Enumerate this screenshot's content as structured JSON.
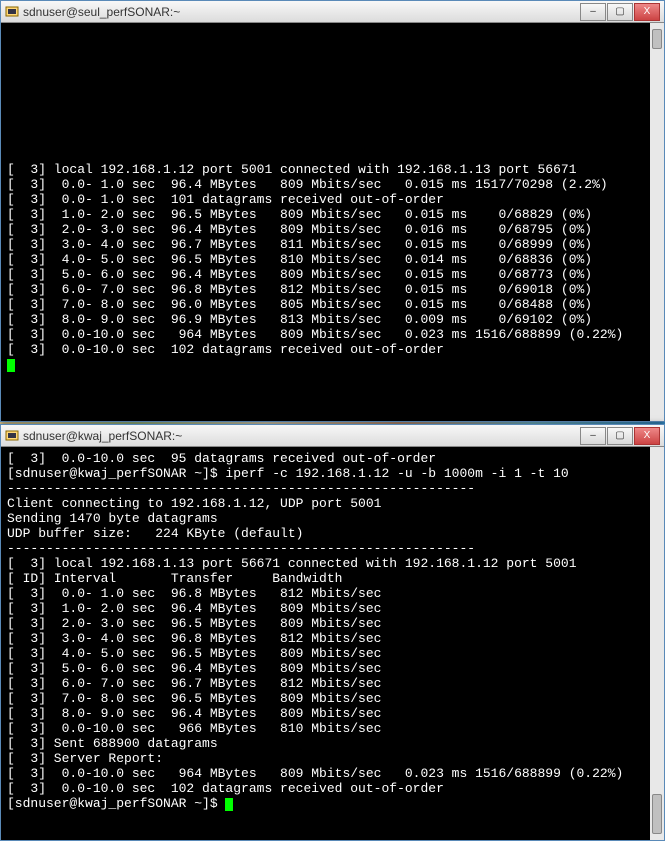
{
  "window1": {
    "title": "sdnuser@seul_perfSONAR:~",
    "server": {
      "connected": "[  3] local 192.168.1.12 port 5001 connected with 192.168.1.13 port 56671",
      "first_row": "[  3]  0.0- 1.0 sec  96.4 MBytes   809 Mbits/sec   0.015 ms 1517/70298 (2.2%)",
      "out_of_order_1": "[  3]  0.0- 1.0 sec  101 datagrams received out-of-order",
      "rows": [
        "[  3]  1.0- 2.0 sec  96.5 MBytes   809 Mbits/sec   0.015 ms    0/68829 (0%)",
        "[  3]  2.0- 3.0 sec  96.4 MBytes   809 Mbits/sec   0.016 ms    0/68795 (0%)",
        "[  3]  3.0- 4.0 sec  96.7 MBytes   811 Mbits/sec   0.015 ms    0/68999 (0%)",
        "[  3]  4.0- 5.0 sec  96.5 MBytes   810 Mbits/sec   0.014 ms    0/68836 (0%)",
        "[  3]  5.0- 6.0 sec  96.4 MBytes   809 Mbits/sec   0.015 ms    0/68773 (0%)",
        "[  3]  6.0- 7.0 sec  96.8 MBytes   812 Mbits/sec   0.015 ms    0/69018 (0%)",
        "[  3]  7.0- 8.0 sec  96.0 MBytes   805 Mbits/sec   0.015 ms    0/68488 (0%)",
        "[  3]  8.0- 9.0 sec  96.9 MBytes   813 Mbits/sec   0.009 ms    0/69102 (0%)"
      ],
      "total_row": "[  3]  0.0-10.0 sec   964 MBytes   809 Mbits/sec   0.023 ms 1516/688899 (0.22%)",
      "out_of_order_2": "[  3]  0.0-10.0 sec  102 datagrams received out-of-order"
    }
  },
  "window2": {
    "title": "sdnuser@kwaj_perfSONAR:~",
    "prev_out_of_order": "[  3]  0.0-10.0 sec  95 datagrams received out-of-order",
    "prompt_cmd": "[sdnuser@kwaj_perfSONAR ~]$ iperf -c 192.168.1.12 -u -b 1000m -i 1 -t 10",
    "dashes": "------------------------------------------------------------",
    "connecting": "Client connecting to 192.168.1.12, UDP port 5001",
    "sending": "Sending 1470 byte datagrams",
    "buffer": "UDP buffer size:   224 KByte (default)",
    "local_conn": "[  3] local 192.168.1.13 port 56671 connected with 192.168.1.12 port 5001",
    "header": "[ ID] Interval       Transfer     Bandwidth",
    "rows": [
      "[  3]  0.0- 1.0 sec  96.8 MBytes   812 Mbits/sec",
      "[  3]  1.0- 2.0 sec  96.4 MBytes   809 Mbits/sec",
      "[  3]  2.0- 3.0 sec  96.5 MBytes   809 Mbits/sec",
      "[  3]  3.0- 4.0 sec  96.8 MBytes   812 Mbits/sec",
      "[  3]  4.0- 5.0 sec  96.5 MBytes   809 Mbits/sec",
      "[  3]  5.0- 6.0 sec  96.4 MBytes   809 Mbits/sec",
      "[  3]  6.0- 7.0 sec  96.7 MBytes   812 Mbits/sec",
      "[  3]  7.0- 8.0 sec  96.5 MBytes   809 Mbits/sec",
      "[  3]  8.0- 9.0 sec  96.4 MBytes   809 Mbits/sec",
      "[  3]  0.0-10.0 sec   966 MBytes   810 Mbits/sec"
    ],
    "sent": "[  3] Sent 688900 datagrams",
    "server_report": "[  3] Server Report:",
    "sr_row": "[  3]  0.0-10.0 sec   964 MBytes   809 Mbits/sec   0.023 ms 1516/688899 (0.22%)",
    "sr_ooo": "[  3]  0.0-10.0 sec  102 datagrams received out-of-order",
    "final_prompt": "[sdnuser@kwaj_perfSONAR ~]$ "
  },
  "controls": {
    "min": "–",
    "max": "▢",
    "close": "X"
  }
}
